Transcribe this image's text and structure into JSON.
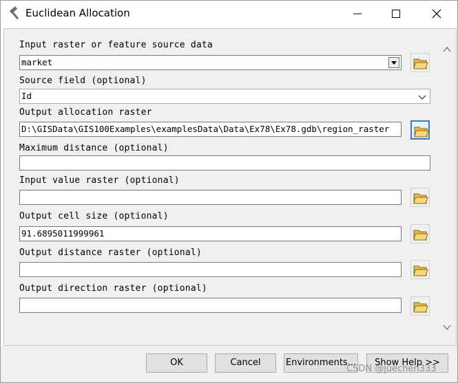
{
  "window": {
    "title": "Euclidean Allocation",
    "title_icon": "hammer-icon",
    "controls": [
      "minimize-icon",
      "maximize-icon",
      "close-icon"
    ]
  },
  "params": [
    {
      "label": "Input raster or feature source data",
      "value": "market",
      "kind": "combo",
      "browse": true
    },
    {
      "label": "Source field (optional)",
      "value": "Id",
      "kind": "dropdown",
      "browse": false
    },
    {
      "label": "Output allocation raster",
      "value": "D:\\GISData\\GIS100Examples\\examplesData\\Data\\Ex78\\Ex78.gdb\\region_raster",
      "kind": "text",
      "browse": true
    },
    {
      "label": "Maximum distance (optional)",
      "value": "",
      "kind": "text",
      "browse": false
    },
    {
      "label": "Input value raster (optional)",
      "value": "",
      "kind": "text",
      "browse": true
    },
    {
      "label": "Output cell size (optional)",
      "value": "91.6895011999961",
      "kind": "text",
      "browse": true
    },
    {
      "label": "Output distance raster (optional)",
      "value": "",
      "kind": "text",
      "browse": true
    },
    {
      "label": "Output direction raster (optional)",
      "value": "",
      "kind": "text",
      "browse": true
    }
  ],
  "buttons": {
    "ok": "OK",
    "cancel": "Cancel",
    "environments": "Environments...",
    "show_help": "Show Help >>"
  },
  "watermark": "CSDN @juechen333",
  "colors": {
    "panel": "#f0f0f0",
    "focus": "#3a78c8",
    "folder": "#e8b84a"
  }
}
